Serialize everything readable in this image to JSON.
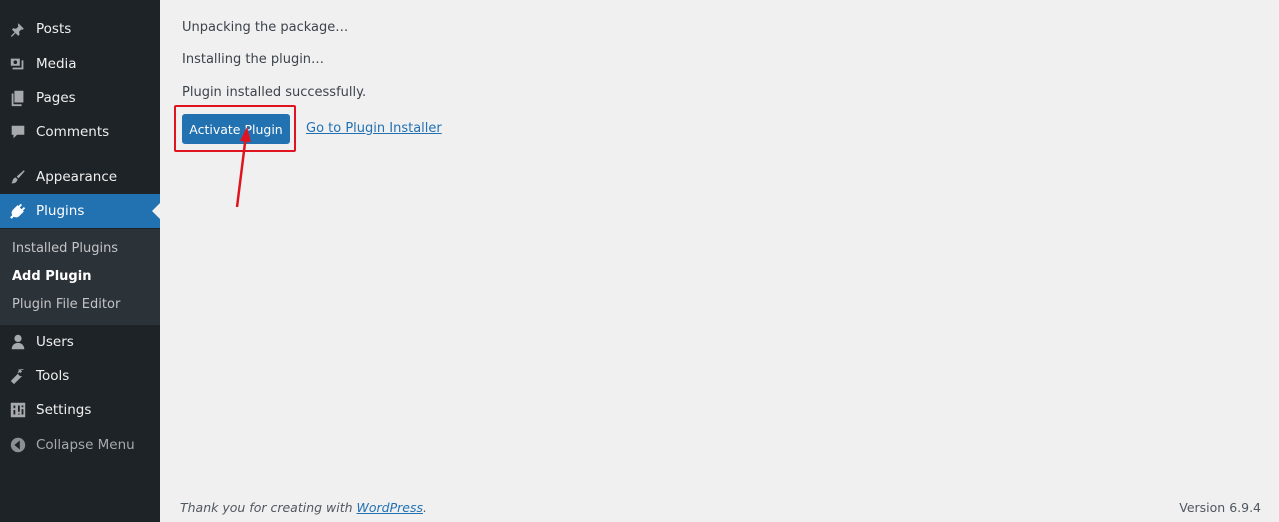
{
  "sidebar": {
    "items": [
      {
        "label": "Posts",
        "icon": "pushpin-icon"
      },
      {
        "label": "Media",
        "icon": "media-icon"
      },
      {
        "label": "Pages",
        "icon": "pages-icon"
      },
      {
        "label": "Comments",
        "icon": "comment-icon"
      },
      {
        "label": "Appearance",
        "icon": "paintbrush-icon"
      },
      {
        "label": "Plugins",
        "icon": "plugin-icon",
        "current": true
      },
      {
        "label": "Users",
        "icon": "user-icon"
      },
      {
        "label": "Tools",
        "icon": "wrench-icon"
      },
      {
        "label": "Settings",
        "icon": "settings-icon"
      },
      {
        "label": "Collapse Menu",
        "icon": "collapse-icon"
      }
    ],
    "submenu": [
      {
        "label": "Installed Plugins"
      },
      {
        "label": "Add Plugin",
        "current": true
      },
      {
        "label": "Plugin File Editor"
      }
    ]
  },
  "main": {
    "messages": [
      "Unpacking the package…",
      "Installing the plugin…",
      "Plugin installed successfully."
    ],
    "activate_button": "Activate Plugin",
    "installer_link": "Go to Plugin Installer"
  },
  "footer": {
    "thanks_prefix": "Thank you for creating with ",
    "thanks_link": "WordPress",
    "thanks_suffix": ".",
    "version": "Version 6.9.4"
  },
  "colors": {
    "sidebar_bg": "#1d2327",
    "submenu_bg": "#2c3338",
    "accent": "#2271b1",
    "highlight": "#e0141e",
    "page_bg": "#f0f0f1"
  }
}
